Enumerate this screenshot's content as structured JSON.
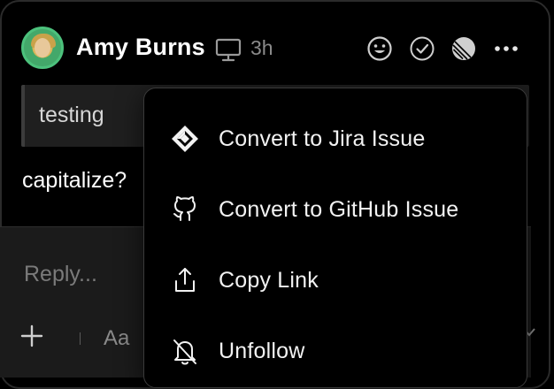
{
  "comment": {
    "author": "Amy Burns",
    "time": "3h",
    "quote": "testing",
    "body": "capitalize?"
  },
  "reply": {
    "placeholder": "Reply...",
    "format_label": "Aa"
  },
  "menu": {
    "items": [
      {
        "label": "Convert to Jira Issue",
        "icon": "jira-icon"
      },
      {
        "label": "Convert to GitHub Issue",
        "icon": "github-icon"
      },
      {
        "label": "Copy Link",
        "icon": "share-icon"
      },
      {
        "label": "Unfollow",
        "icon": "bell-off-icon"
      }
    ]
  },
  "colors": {
    "background": "#000000",
    "muted_text": "#8a8a8a",
    "avatar_ring": "#4cc17c"
  }
}
